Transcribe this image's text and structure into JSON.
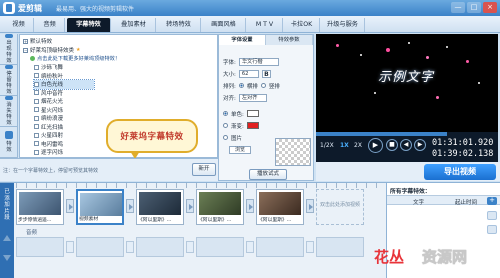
{
  "window": {
    "app_name": "爱剪辑",
    "slogan": "最易用、强大的视频剪辑软件",
    "min_label": "—",
    "max_label": "□",
    "close_label": "×"
  },
  "tabs": [
    {
      "label": "视频"
    },
    {
      "label": "音频"
    },
    {
      "label": "字幕特效"
    },
    {
      "label": "叠加素材"
    },
    {
      "label": "转场特效"
    },
    {
      "label": "画面风格"
    },
    {
      "label": "M T V"
    },
    {
      "label": "卡拉OK"
    },
    {
      "label": "升级与服务"
    }
  ],
  "sidebar": {
    "items": [
      {
        "label": "出现特效"
      },
      {
        "label": "停留特效"
      },
      {
        "label": "消失特效"
      },
      {
        "label": "特效"
      }
    ]
  },
  "effects": {
    "group_default": "默认特效",
    "group_favorites": "好莱坞顶级特效类",
    "hint": "点击此处下载更多好莱坞顶级特效！",
    "items": [
      {
        "label": "沙砾飞舞"
      },
      {
        "label": "缤纷秋叶"
      },
      {
        "label": "白色光线"
      },
      {
        "label": "风中音符"
      },
      {
        "label": "烟花火光"
      },
      {
        "label": "星火闪烁"
      },
      {
        "label": "缤纷浪漫"
      },
      {
        "label": "红光扫描"
      },
      {
        "label": "火星四射"
      },
      {
        "label": "电闪雷鸣"
      },
      {
        "label": "逐字闪烁"
      },
      {
        "label": "蓝光散射"
      }
    ],
    "callout": "好莱坞字幕特效"
  },
  "left_bottom": {
    "tip": "注：在一个字幕特效上，停留可预览其特效",
    "apply_label": "新开"
  },
  "settings": {
    "tab_font": "字体设置",
    "tab_effect": "特效参数",
    "font_label": "字体:",
    "font_value": "华文行楷",
    "size_label": "大小:",
    "size_value": "62",
    "bold_label": "B",
    "arrange_label": "排列:",
    "horizontal": "横排",
    "vertical": "竖排",
    "align_label": "对齐:",
    "align_value": "左对齐",
    "single_color": "单色:",
    "gradient": "渐变:",
    "image": "图片",
    "browse": "浏览",
    "preview_label": "播放试式",
    "single_color_hex": "#ffffff",
    "gradient_hex": "#e02020"
  },
  "preview": {
    "overlay_text": "示例文字",
    "progress": 0.72,
    "speeds": [
      "1/2X",
      "1X",
      "2X"
    ],
    "current_time": "01:31:01.920",
    "total_time": "01:39:02.138",
    "prev_icon": "previous-icon",
    "play_icon": "play-icon",
    "stop_icon": "stop-icon",
    "next_icon": "next-icon"
  },
  "export": {
    "label": "导出视频"
  },
  "timeline": {
    "side_label": "已添加片段",
    "clips": [
      {
        "caption": "步步惊情逍遥..."
      },
      {
        "caption": "视频素材"
      },
      {
        "caption": "《阿以里斯》..."
      },
      {
        "caption": "《阿以里斯》..."
      },
      {
        "caption": "《阿以里斯》..."
      },
      {
        "caption": "《阿以里斯》..."
      }
    ],
    "placeholder": "双击此处添加视频",
    "audio_label": "音频"
  },
  "subtitles_panel": {
    "title": "所有字幕特效：",
    "col_text": "文字",
    "col_time": "起止时间",
    "add_label": "+"
  },
  "watermark": {
    "part_a": "花丛",
    "part_b": "资源网"
  },
  "colors": {
    "accent": "#3b82c8",
    "dark": "#0d1a2a",
    "callout_text": "#c0392b"
  }
}
